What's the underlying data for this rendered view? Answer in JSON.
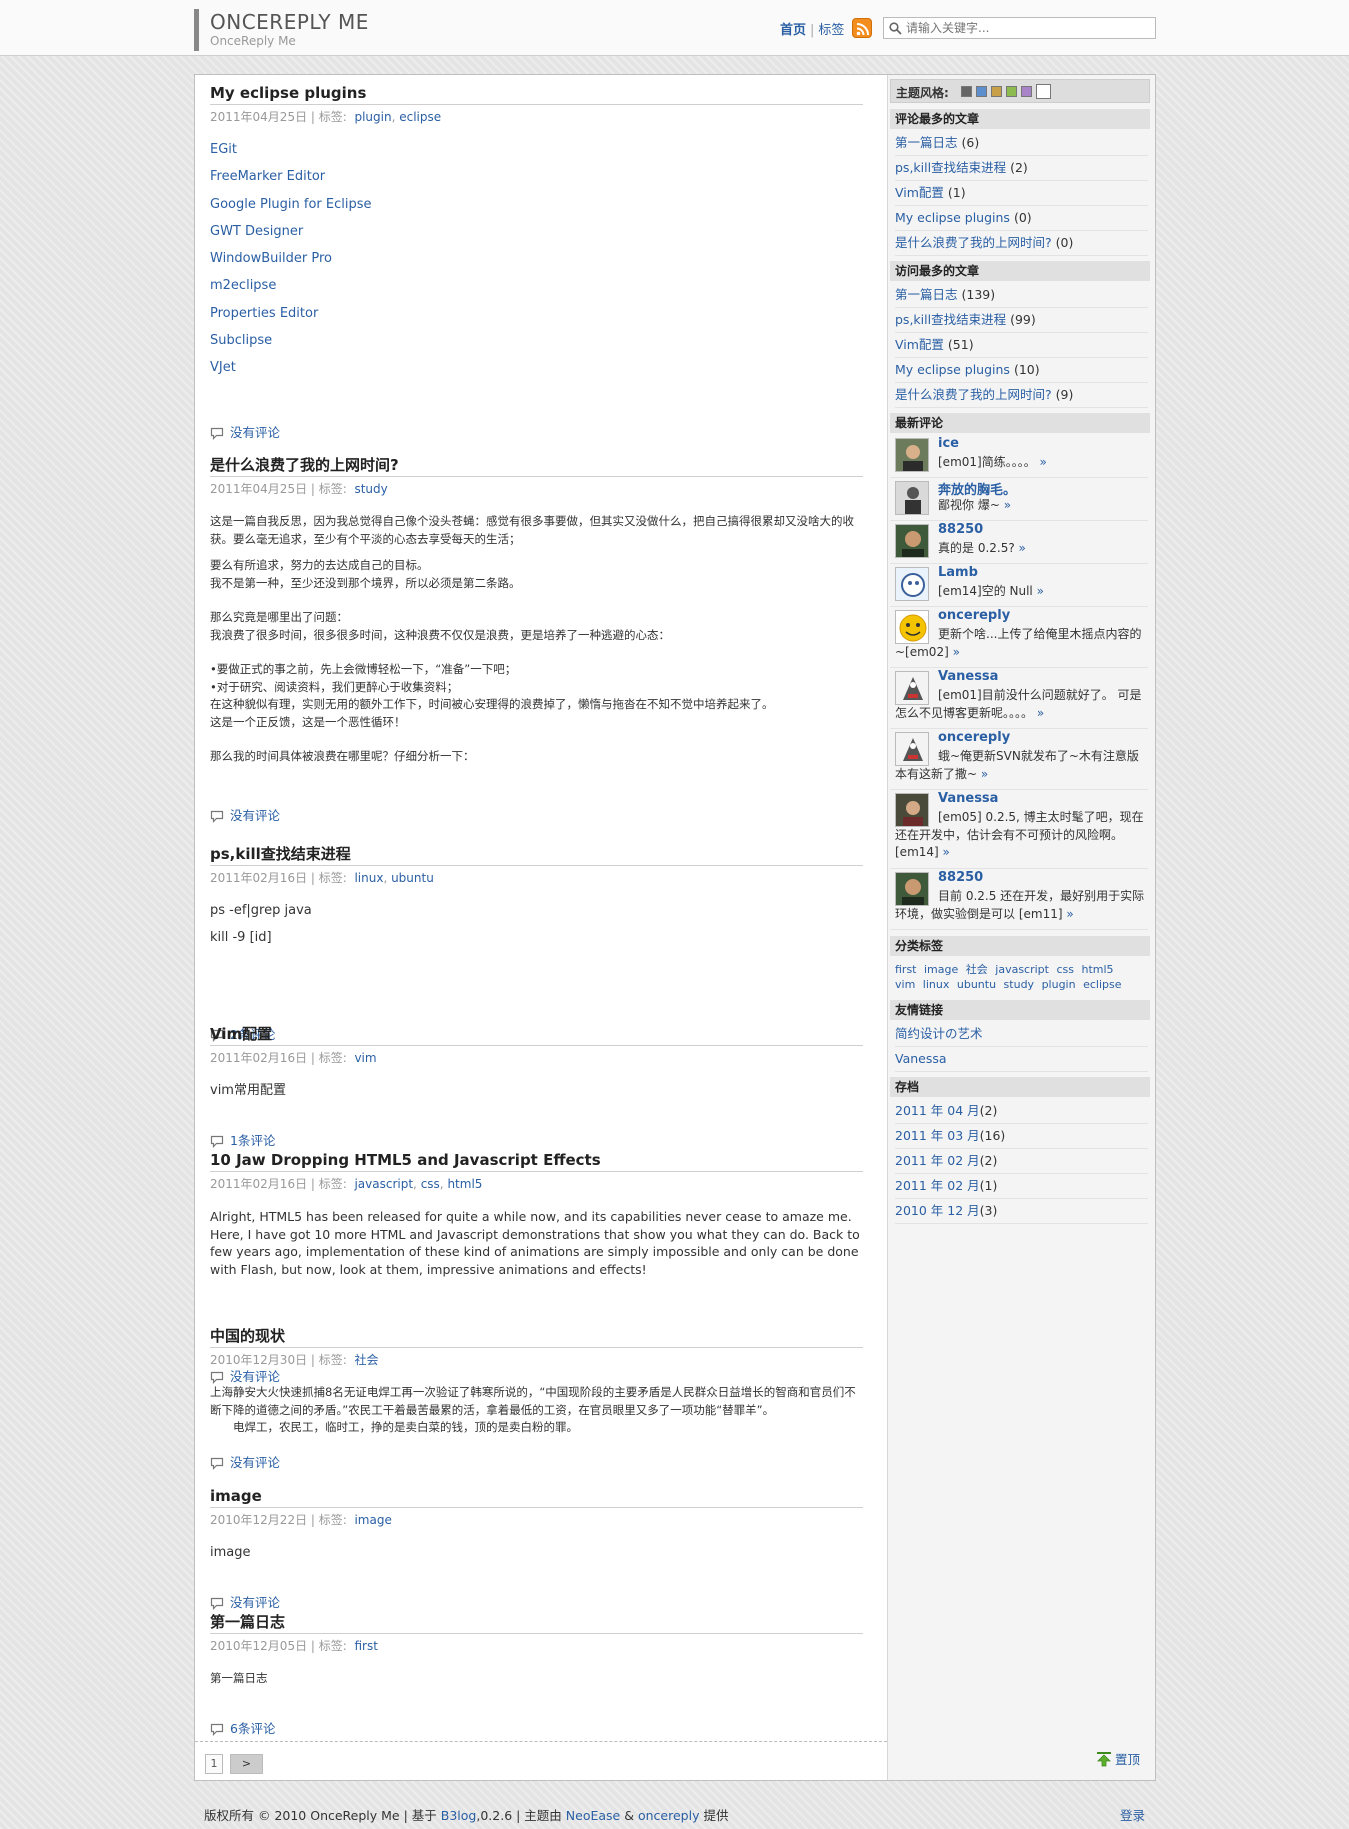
{
  "site": {
    "title": "ONCEREPLY ME",
    "subtitle": "OnceReply Me"
  },
  "nav": {
    "home": "首页",
    "tags": "标签"
  },
  "search": {
    "placeholder": "请输入关键字..."
  },
  "posts": [
    {
      "title": "My eclipse plugins",
      "date": "2011年04月25日",
      "tag_label": "标签:",
      "tags": [
        "plugin",
        "eclipse"
      ],
      "links": [
        "EGit",
        "FreeMarker Editor",
        "Google Plugin for Eclipse",
        "GWT Designer",
        "WindowBuilder Pro",
        "m2eclipse",
        "Properties Editor",
        "Subclipse",
        "VJet"
      ],
      "comments": "没有评论"
    },
    {
      "title": "是什么浪费了我的上网时间?",
      "date": "2011年04月25日",
      "tag_label": "标签:",
      "tags": [
        "study"
      ],
      "paragraphs": [
        "这是一篇自我反思，因为我总觉得自己像个没头苍蝇：感觉有很多事要做，但其实又没做什么，把自己搞得很累却又没啥大的收获。要么毫无追求，至少有个平淡的心态去享受每天的生活；",
        "要么有所追求，努力的去达成自己的目标。",
        "我不是第一种，至少还没到那个境界，所以必须是第二条路。",
        "那么究竟是哪里出了问题：",
        "我浪费了很多时间，很多很多时间，这种浪费不仅仅是浪费，更是培养了一种逃避的心态：",
        "•要做正式的事之前，先上会微博轻松一下，“准备”一下吧；",
        "•对于研究、阅读资料，我们更醉心于收集资料；",
        "在这种貌似有理，实则无用的额外工作下，时间被心安理得的浪费掉了，懒惰与拖沓在不知不觉中培养起来了。",
        "这是一个正反馈，这是一个恶性循环！",
        "那么我的时间具体被浪费在哪里呢？仔细分析一下："
      ],
      "comments": "没有评论"
    },
    {
      "title": "ps,kill查找结束进程",
      "date": "2011年02月16日",
      "tag_label": "标签:",
      "tags": [
        "linux",
        "ubuntu"
      ],
      "paragraphs": [
        "ps -ef|grep java",
        "kill -9 [id]"
      ],
      "comments": "2条评论"
    },
    {
      "title": "Vim配置",
      "date": "2011年02月16日",
      "tag_label": "标签:",
      "tags": [
        "vim"
      ],
      "paragraphs": [
        "vim常用配置"
      ],
      "comments": "1条评论"
    },
    {
      "title": "10 Jaw Dropping HTML5 and Javascript Effects",
      "date": "2011年02月16日",
      "tag_label": "标签:",
      "tags": [
        "javascript",
        "css",
        "html5"
      ],
      "paragraphs": [
        "Alright, HTML5 has been released for quite a while now, and its capabilities never cease to amaze me. Here, I have got 10 more HTML and Javascript demonstrations that show you what they can do. Back to few years ago, implementation of these kind of animations are simply impossible and only can be done with Flash, but now, look at them, impressive animations and effects!"
      ],
      "comments": "没有评论"
    },
    {
      "title": "中国的现状",
      "date": "2010年12月30日",
      "tag_label": "标签:",
      "tags": [
        "社会"
      ],
      "paragraphs": [
        "上海静安大火快速抓捕8名无证电焊工再一次验证了韩寒所说的，“中国现阶段的主要矛盾是人民群众日益增长的智商和官员们不断下降的道德之间的矛盾。”农民工干着最苦最累的活，拿着最低的工资，在官员眼里又多了一项功能“替罪羊”。",
        "电焊工，农民工，临时工，挣的是卖白菜的钱，顶的是卖白粉的罪。"
      ],
      "comments": "没有评论"
    },
    {
      "title": "image",
      "date": "2010年12月22日",
      "tag_label": "标签:",
      "tags": [
        "image"
      ],
      "paragraphs": [
        "image"
      ],
      "comments": "没有评论"
    },
    {
      "title": "第一篇日志",
      "date": "2010年12月05日",
      "tag_label": "标签:",
      "tags": [
        "first"
      ],
      "paragraphs": [
        "第一篇日志"
      ],
      "comments": "6条评论"
    }
  ],
  "pager": {
    "page": "1",
    "next": ">"
  },
  "sidebar": {
    "theme_label": "主题风格:",
    "theme_colors": [
      "#666666",
      "#5d8fcf",
      "#c8a04a",
      "#8dbb4f",
      "#a983c8",
      "#ffffff"
    ],
    "most_commented": {
      "title": "评论最多的文章",
      "items": [
        {
          "name": "第一篇日志",
          "count": "(6)"
        },
        {
          "name": "ps,kill查找结束进程",
          "count": "(2)"
        },
        {
          "name": "Vim配置",
          "count": "(1)"
        },
        {
          "name": "My eclipse plugins",
          "count": "(0)"
        },
        {
          "name": "是什么浪费了我的上网时间?",
          "count": "(0)"
        }
      ]
    },
    "most_visited": {
      "title": "访问最多的文章",
      "items": [
        {
          "name": "第一篇日志",
          "count": "(139)"
        },
        {
          "name": "ps,kill查找结束进程",
          "count": "(99)"
        },
        {
          "name": "Vim配置",
          "count": "(51)"
        },
        {
          "name": "My eclipse plugins",
          "count": "(10)"
        },
        {
          "name": "是什么浪费了我的上网时间?",
          "count": "(9)"
        }
      ]
    },
    "recent_comments": {
      "title": "最新评论",
      "more": "»",
      "items": [
        {
          "name": "ice",
          "text": "[em01]简练。。。。"
        },
        {
          "name": "奔放的胸毛。",
          "text": "鄙视你 爆~"
        },
        {
          "name": "88250",
          "text": "真的是 0.2.5?"
        },
        {
          "name": "Lamb",
          "text": "[em14]空的 Null"
        },
        {
          "name": "oncereply",
          "text": "更新个啥...上传了给俺里木摇点内容的~[em02]"
        },
        {
          "name": "Vanessa",
          "text": "[em01]目前没什么问题就好了。 可是怎么不见博客更新呢。。。。"
        },
        {
          "name": "oncereply",
          "text": "蛾~俺更新SVN就发布了~木有注意版本有这新了撒~"
        },
        {
          "name": "Vanessa",
          "text": "[em05] 0.2.5, 博主太时髦了吧，现在还在开发中，估计会有不可预计的风险啊。[em14]"
        },
        {
          "name": "88250",
          "text": "目前 0.2.5 还在开发，最好别用于实际环境，做实验倒是可以 [em11]"
        }
      ]
    },
    "tags": {
      "title": "分类标签",
      "items": [
        "first",
        "image",
        "社会",
        "javascript",
        "css",
        "html5",
        "vim",
        "linux",
        "ubuntu",
        "study",
        "plugin",
        "eclipse"
      ]
    },
    "friend_links": {
      "title": "友情链接",
      "items": [
        "简约设计の艺术",
        "Vanessa"
      ]
    },
    "archive": {
      "title": "存档",
      "items": [
        {
          "month": "2011 年 04 月",
          "count": "(2)"
        },
        {
          "month": "2011 年 03 月",
          "count": "(16)"
        },
        {
          "month": "2011 年 02 月",
          "count": "(2)"
        },
        {
          "month": "2011 年 02 月",
          "count": "(1)"
        },
        {
          "month": "2010 年 12 月",
          "count": "(3)"
        }
      ]
    },
    "back_to_top": "置顶"
  },
  "footer": {
    "copyright": "版权所有 © 2010 OnceReply Me | 基于",
    "b3log": "B3log",
    "version": ",0.2.6 | 主题由",
    "neoease": "NeoEase",
    "amp": "&",
    "oncereply": "oncereply",
    "provided": "提供",
    "login": "登录"
  }
}
